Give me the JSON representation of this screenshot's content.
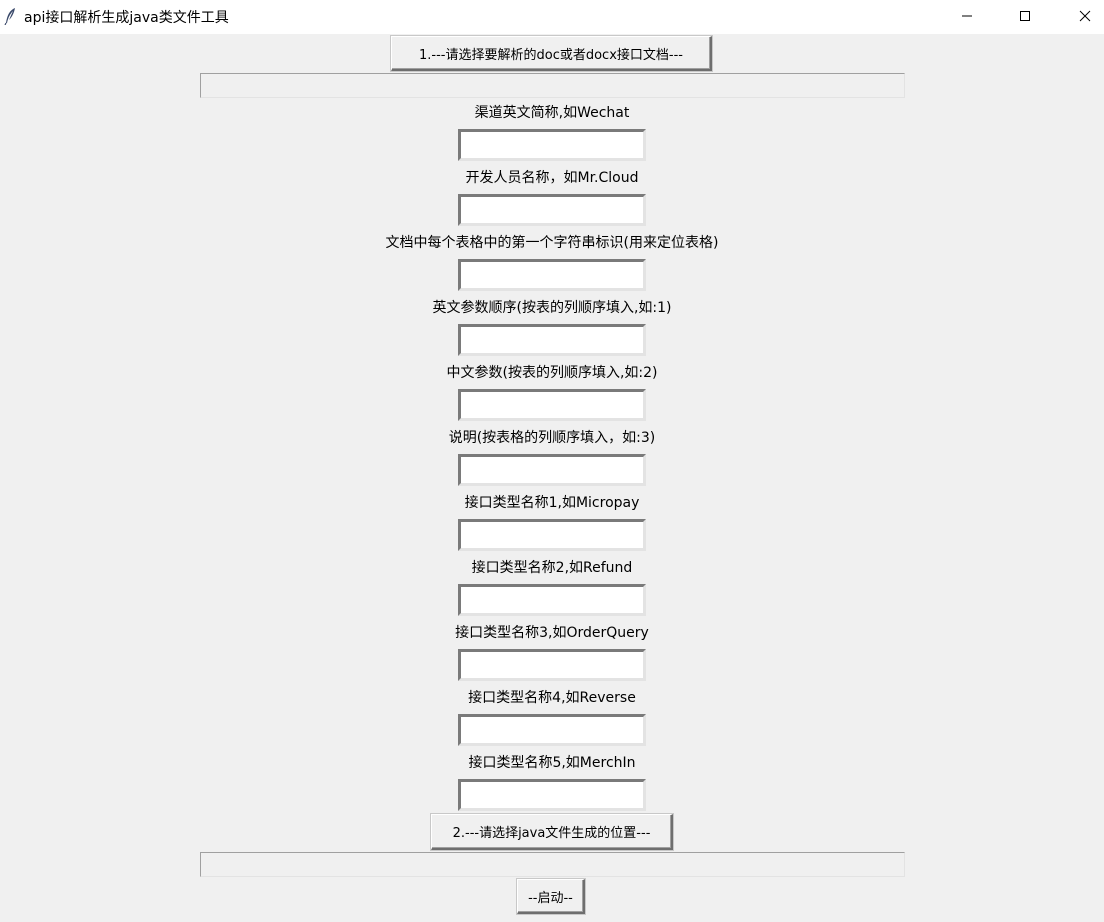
{
  "window": {
    "title": "api接口解析生成java类文件工具",
    "icon": "feather-icon",
    "controls": [
      "minimize-icon",
      "maximize-icon",
      "close-icon"
    ]
  },
  "select_doc_button": "1.---请选择要解析的doc或者docx接口文档---",
  "doc_path_value": "",
  "fields": [
    {
      "label": "渠道英文简称,如Wechat",
      "value": ""
    },
    {
      "label": "开发人员名称，如Mr.Cloud",
      "value": ""
    },
    {
      "label": "文档中每个表格中的第一个字符串标识(用来定位表格)",
      "value": ""
    },
    {
      "label": "英文参数顺序(按表的列顺序填入,如:1)",
      "value": ""
    },
    {
      "label": "中文参数(按表的列顺序填入,如:2)",
      "value": ""
    },
    {
      "label": "说明(按表格的列顺序填入，如:3)",
      "value": ""
    },
    {
      "label": "接口类型名称1,如Micropay",
      "value": ""
    },
    {
      "label": "接口类型名称2,如Refund",
      "value": ""
    },
    {
      "label": "接口类型名称3,如OrderQuery",
      "value": ""
    },
    {
      "label": "接口类型名称4,如Reverse",
      "value": ""
    },
    {
      "label": "接口类型名称5,如MerchIn",
      "value": ""
    }
  ],
  "select_output_button": "2.---请选择java文件生成的位置---",
  "output_path_value": "",
  "start_button": "--启动--"
}
